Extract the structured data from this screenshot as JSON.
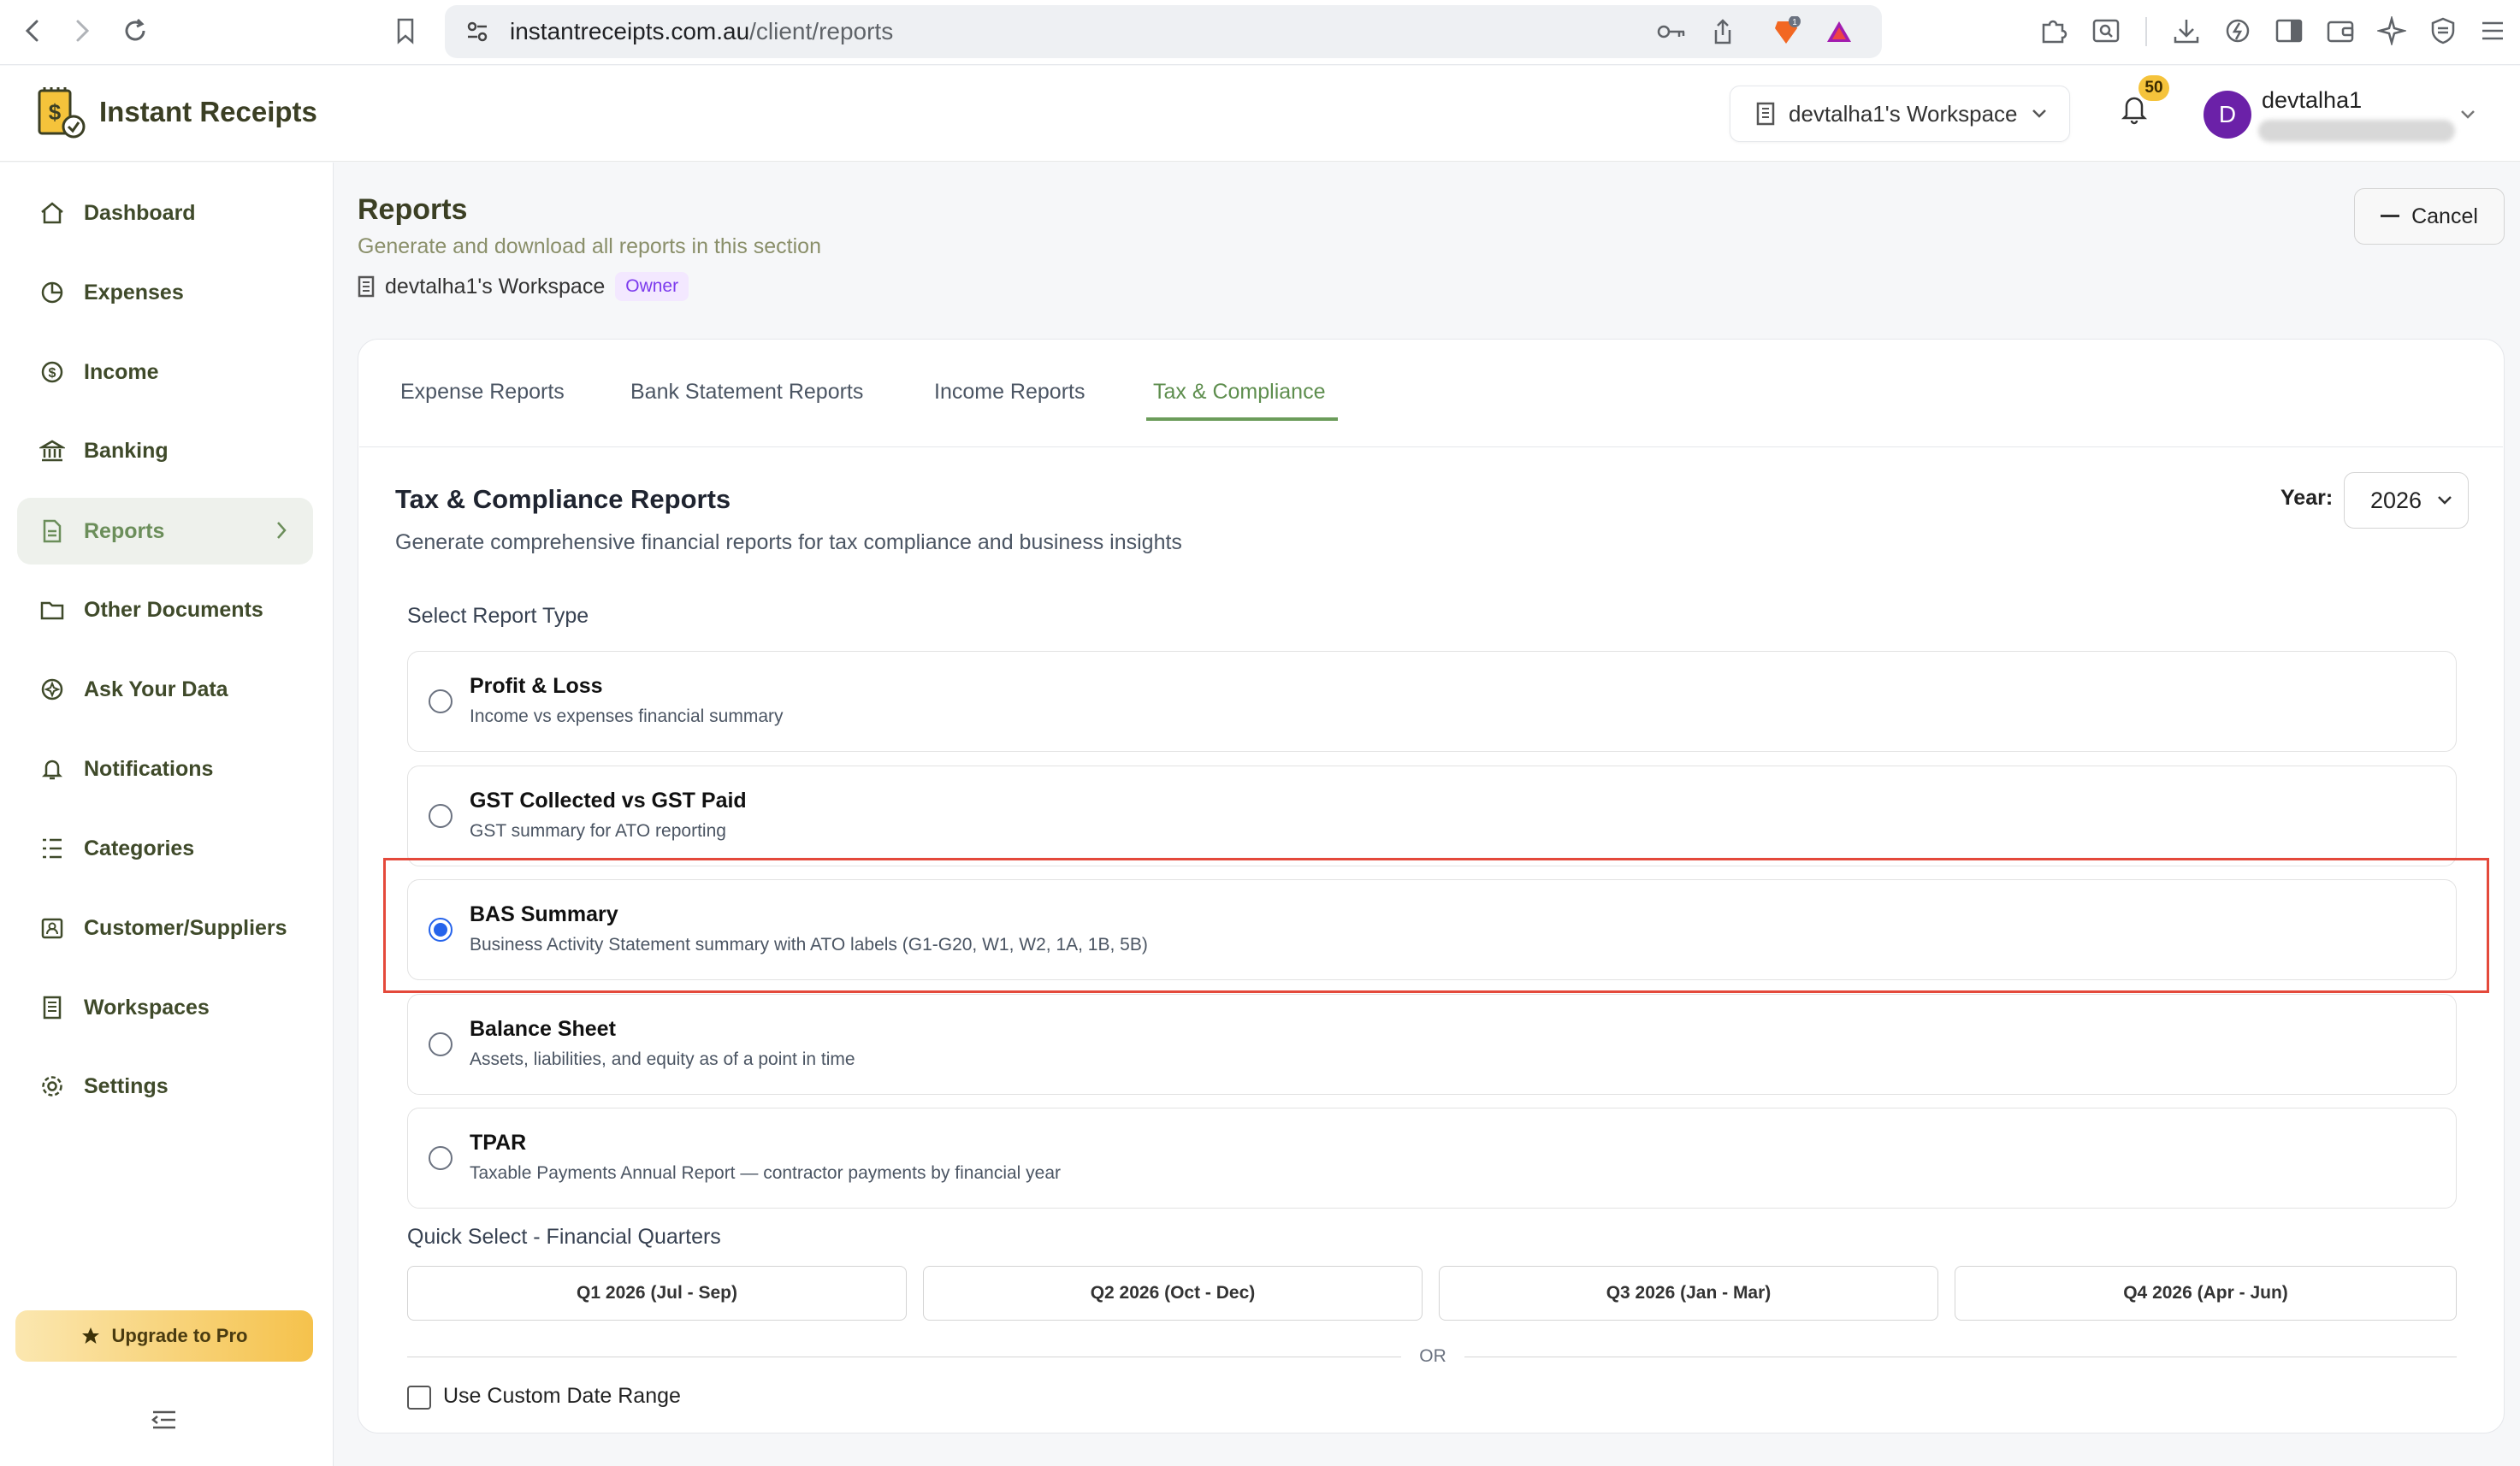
{
  "browser": {
    "url_host": "instantreceipts.com.au",
    "url_path": "/client/reports",
    "extension_badge": "1"
  },
  "header": {
    "brand": "Instant Receipts",
    "workspace_button": "devtalha1's Workspace",
    "notification_count": "50",
    "avatar_initial": "D",
    "user_name": "devtalha1"
  },
  "sidebar": {
    "items": [
      {
        "label": "Dashboard",
        "icon": "home-icon"
      },
      {
        "label": "Expenses",
        "icon": "pie-chart-icon"
      },
      {
        "label": "Income",
        "icon": "dollar-circle-icon"
      },
      {
        "label": "Banking",
        "icon": "bank-icon"
      },
      {
        "label": "Reports",
        "icon": "document-icon",
        "active": true
      },
      {
        "label": "Other Documents",
        "icon": "folder-icon"
      },
      {
        "label": "Ask Your Data",
        "icon": "ai-spark-icon"
      },
      {
        "label": "Notifications",
        "icon": "bell-icon"
      },
      {
        "label": "Categories",
        "icon": "list-icon"
      },
      {
        "label": "Customer/Suppliers",
        "icon": "contact-card-icon"
      },
      {
        "label": "Workspaces",
        "icon": "building-icon"
      },
      {
        "label": "Settings",
        "icon": "gear-icon"
      }
    ],
    "upgrade_label": "Upgrade to Pro"
  },
  "page": {
    "title": "Reports",
    "subtitle": "Generate and download all reports in this section",
    "workspace": "devtalha1's Workspace",
    "role_badge": "Owner",
    "cancel_label": "Cancel"
  },
  "tabs": [
    {
      "label": "Expense Reports"
    },
    {
      "label": "Bank Statement Reports"
    },
    {
      "label": "Income Reports"
    },
    {
      "label": "Tax & Compliance",
      "active": true
    }
  ],
  "section": {
    "title": "Tax & Compliance Reports",
    "subtitle": "Generate comprehensive financial reports for tax compliance and business insights",
    "year_label": "Year:",
    "year_value": "2026",
    "select_type_label": "Select Report Type"
  },
  "report_options": [
    {
      "title": "Profit & Loss",
      "desc": "Income vs expenses financial summary",
      "selected": false
    },
    {
      "title": "GST Collected vs GST Paid",
      "desc": "GST summary for ATO reporting",
      "selected": false
    },
    {
      "title": "BAS Summary",
      "desc": "Business Activity Statement summary with ATO labels (G1-G20, W1, W2, 1A, 1B, 5B)",
      "selected": true
    },
    {
      "title": "Balance Sheet",
      "desc": "Assets, liabilities, and equity as of a point in time",
      "selected": false
    },
    {
      "title": "TPAR",
      "desc": "Taxable Payments Annual Report — contractor payments by financial year",
      "selected": false
    }
  ],
  "quick_select": {
    "label": "Quick Select - Financial Quarters",
    "quarters": [
      "Q1 2026 (Jul - Sep)",
      "Q2 2026 (Oct - Dec)",
      "Q3 2026 (Jan - Mar)",
      "Q4 2026 (Apr - Jun)"
    ],
    "or_text": "OR",
    "custom_range_label": "Use Custom Date Range"
  },
  "colors": {
    "accent_green": "#6b9c5a",
    "radio_selected": "#2563eb",
    "highlight_box": "#e4493b",
    "avatar_bg": "#6b21a8",
    "badge_yellow": "#f5c33b"
  }
}
